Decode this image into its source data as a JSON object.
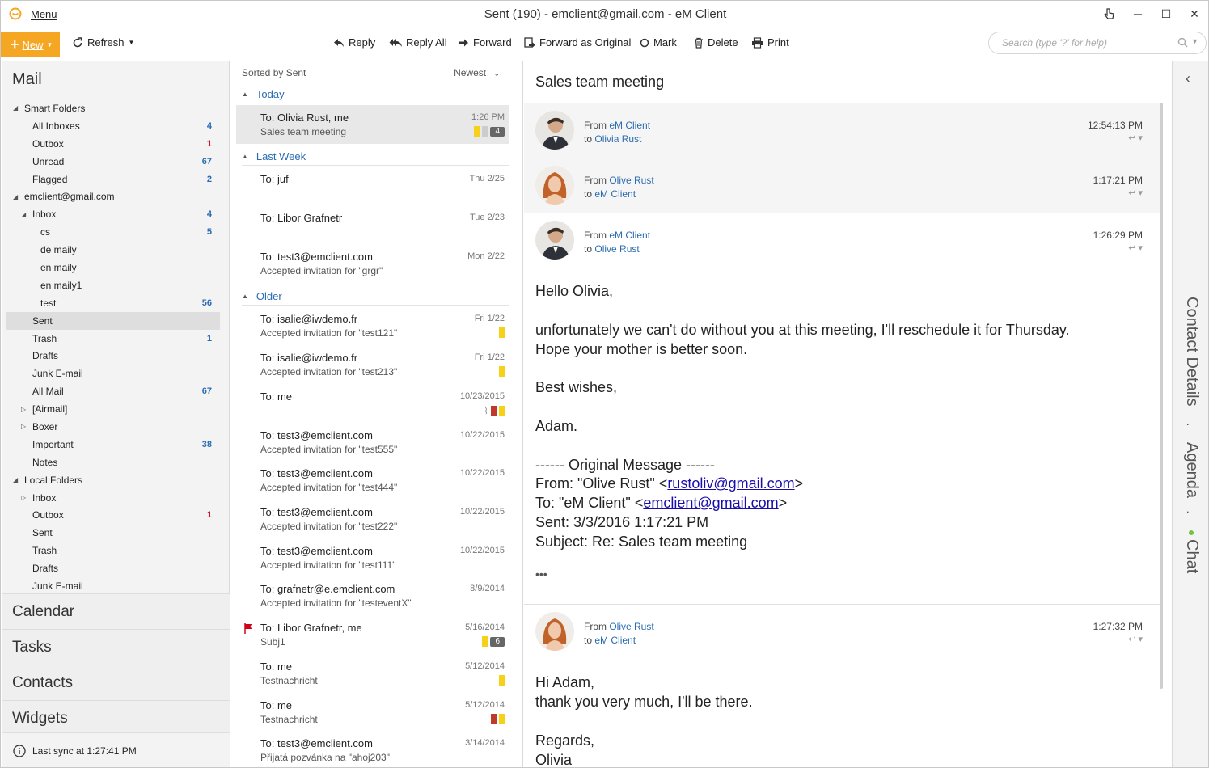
{
  "app": {
    "menu_label": "Menu",
    "window_title": "Sent (190) - emclient@gmail.com - eM Client"
  },
  "toolbar": {
    "new_label": "New",
    "refresh_label": "Refresh",
    "reply_label": "Reply",
    "reply_all_label": "Reply All",
    "forward_label": "Forward",
    "forward_original_label": "Forward as Original",
    "mark_label": "Mark",
    "delete_label": "Delete",
    "print_label": "Print",
    "search_placeholder": "Search (type '?' for help)"
  },
  "sidebar": {
    "header": "Mail",
    "items": [
      {
        "label": "Smart Folders",
        "count": "",
        "level": 0,
        "tri": "▲",
        "red": false
      },
      {
        "label": "All Inboxes",
        "count": "4",
        "level": 1,
        "tri": "",
        "red": false
      },
      {
        "label": "Outbox",
        "count": "1",
        "level": 1,
        "tri": "",
        "red": true
      },
      {
        "label": "Unread",
        "count": "67",
        "level": 1,
        "tri": "",
        "red": false
      },
      {
        "label": "Flagged",
        "count": "2",
        "level": 1,
        "tri": "",
        "red": false
      },
      {
        "label": "emclient@gmail.com",
        "count": "",
        "level": 0,
        "tri": "▲",
        "red": false
      },
      {
        "label": "Inbox",
        "count": "4",
        "level": 1,
        "tri": "▲",
        "red": false
      },
      {
        "label": "cs",
        "count": "5",
        "level": 2,
        "tri": "",
        "red": false
      },
      {
        "label": "de maily",
        "count": "",
        "level": 2,
        "tri": "",
        "red": false
      },
      {
        "label": "en maily",
        "count": "",
        "level": 2,
        "tri": "",
        "red": false
      },
      {
        "label": "en maily1",
        "count": "",
        "level": 2,
        "tri": "",
        "red": false
      },
      {
        "label": "test",
        "count": "56",
        "level": 2,
        "tri": "",
        "red": false
      },
      {
        "label": "Sent",
        "count": "",
        "level": 1,
        "tri": "",
        "red": false,
        "selected": true
      },
      {
        "label": "Trash",
        "count": "1",
        "level": 1,
        "tri": "",
        "red": false
      },
      {
        "label": "Drafts",
        "count": "",
        "level": 1,
        "tri": "",
        "red": false
      },
      {
        "label": "Junk E-mail",
        "count": "",
        "level": 1,
        "tri": "",
        "red": false
      },
      {
        "label": "All Mail",
        "count": "67",
        "level": 1,
        "tri": "",
        "red": false
      },
      {
        "label": "[Airmail]",
        "count": "",
        "level": 1,
        "tri": "▷",
        "red": false
      },
      {
        "label": "Boxer",
        "count": "",
        "level": 1,
        "tri": "▷",
        "red": false
      },
      {
        "label": "Important",
        "count": "38",
        "level": 1,
        "tri": "",
        "red": false
      },
      {
        "label": "Notes",
        "count": "",
        "level": 1,
        "tri": "",
        "red": false
      },
      {
        "label": "Local Folders",
        "count": "",
        "level": 0,
        "tri": "▲",
        "red": false
      },
      {
        "label": "Inbox",
        "count": "",
        "level": 1,
        "tri": "▷",
        "red": false
      },
      {
        "label": "Outbox",
        "count": "1",
        "level": 1,
        "tri": "",
        "red": true
      },
      {
        "label": "Sent",
        "count": "",
        "level": 1,
        "tri": "",
        "red": false
      },
      {
        "label": "Trash",
        "count": "",
        "level": 1,
        "tri": "",
        "red": false
      },
      {
        "label": "Drafts",
        "count": "",
        "level": 1,
        "tri": "",
        "red": false
      },
      {
        "label": "Junk E-mail",
        "count": "",
        "level": 1,
        "tri": "",
        "red": false
      }
    ],
    "nav": {
      "calendar": "Calendar",
      "tasks": "Tasks",
      "contacts": "Contacts",
      "widgets": "Widgets"
    },
    "status": "Last sync at 1:27:41 PM"
  },
  "list": {
    "sorted_by": "Sorted by Sent",
    "order": "Newest",
    "groups": {
      "today": "Today",
      "last_week": "Last Week",
      "older": "Older"
    },
    "messages": [
      {
        "to": "To: Olivia Rust, me",
        "subject": "Sales team meeting",
        "date": "1:26 PM",
        "tags": [
          "y",
          "g"
        ],
        "badge": "4",
        "selected": true
      },
      {
        "to": "To: juf",
        "subject": "",
        "date": "Thu 2/25",
        "tags": [],
        "badge": ""
      },
      {
        "to": "To: Libor Grafnetr",
        "subject": "",
        "date": "Tue 2/23",
        "tags": [],
        "badge": ""
      },
      {
        "to": "To: test3@emclient.com",
        "subject": "Accepted invitation for \"grgr\"",
        "date": "Mon 2/22",
        "tags": [],
        "badge": ""
      },
      {
        "to": "To: isalie@iwdemo.fr",
        "subject": "Accepted invitation for \"test121\"",
        "date": "Fri 1/22",
        "tags": [
          "y"
        ],
        "badge": ""
      },
      {
        "to": "To: isalie@iwdemo.fr",
        "subject": "Accepted invitation for \"test213\"",
        "date": "Fri 1/22",
        "tags": [
          "y"
        ],
        "badge": ""
      },
      {
        "to": "To: me",
        "subject": "",
        "date": "10/23/2015",
        "tags": [
          "r",
          "y"
        ],
        "badge": "",
        "attachment": true
      },
      {
        "to": "To: test3@emclient.com",
        "subject": "Accepted invitation for \"test555\"",
        "date": "10/22/2015",
        "tags": [],
        "badge": ""
      },
      {
        "to": "To: test3@emclient.com",
        "subject": "Accepted invitation for \"test444\"",
        "date": "10/22/2015",
        "tags": [],
        "badge": ""
      },
      {
        "to": "To: test3@emclient.com",
        "subject": "Accepted invitation for \"test222\"",
        "date": "10/22/2015",
        "tags": [],
        "badge": ""
      },
      {
        "to": "To: test3@emclient.com",
        "subject": "Accepted invitation for \"test111\"",
        "date": "10/22/2015",
        "tags": [],
        "badge": ""
      },
      {
        "to": "To: grafnetr@e.emclient.com",
        "subject": "Accepted invitation for \"testeventX\"",
        "date": "8/9/2014",
        "tags": [],
        "badge": ""
      },
      {
        "to": "To: Libor Grafnetr, me",
        "subject": "Subj1",
        "date": "5/16/2014",
        "tags": [
          "y"
        ],
        "badge": "6",
        "flagged": true
      },
      {
        "to": "To: me",
        "subject": "Testnachricht",
        "date": "5/12/2014",
        "tags": [
          "y"
        ],
        "badge": ""
      },
      {
        "to": "To: me",
        "subject": "Testnachricht",
        "date": "5/12/2014",
        "tags": [
          "r",
          "y"
        ],
        "badge": ""
      },
      {
        "to": "To: test3@emclient.com",
        "subject": "Přijatá pozvánka na \"ahoj203\"",
        "date": "3/14/2014",
        "tags": [],
        "badge": ""
      }
    ]
  },
  "reading": {
    "subject": "Sales team meeting",
    "headers": [
      {
        "from_prefix": "From",
        "from": "eM Client",
        "to_prefix": "to",
        "to": "Olivia Rust",
        "time": "12:54:13 PM"
      },
      {
        "from_prefix": "From",
        "from": "Olive Rust",
        "to_prefix": "to",
        "to": "eM Client",
        "time": "1:17:21 PM"
      },
      {
        "from_prefix": "From",
        "from": "eM Client",
        "to_prefix": "to",
        "to": "Olive Rust",
        "time": "1:26:29 PM"
      },
      {
        "from_prefix": "From",
        "from": "Olive Rust",
        "to_prefix": "to",
        "to": "eM Client",
        "time": "1:27:32 PM"
      }
    ],
    "body1": {
      "greeting": "Hello Olivia,",
      "line1": "unfortunately we can't do without you at this meeting, I'll reschedule it for Thursday.",
      "line2": "Hope your mother is better soon.",
      "closing": "Best wishes,",
      "signature": "Adam.",
      "orig_header": "------ Original Message ------",
      "orig_from_prefix": "From: \"Olive Rust\" <",
      "orig_from_email": "rustoliv@gmail.com",
      "orig_from_suffix": ">",
      "orig_to_prefix": "To: \"eM Client\" <",
      "orig_to_email": "emclient@gmail.com",
      "orig_to_suffix": ">",
      "orig_sent": "Sent: 3/3/2016 1:17:21 PM",
      "orig_subject": "Subject: Re: Sales team meeting",
      "more": "•••"
    },
    "body2": {
      "greeting": "Hi Adam,",
      "line1": "thank you very much, I'll be there.",
      "closing": "Regards,",
      "signature": "Olivia"
    }
  },
  "rightbar": {
    "contact_details": "Contact Details",
    "agenda": "Agenda",
    "chat": "Chat",
    "separator": "·"
  },
  "colors": {
    "accent": "#f5a623",
    "link": "#2b6cb0",
    "count_red": "#d0021b",
    "online": "#7ac143"
  }
}
